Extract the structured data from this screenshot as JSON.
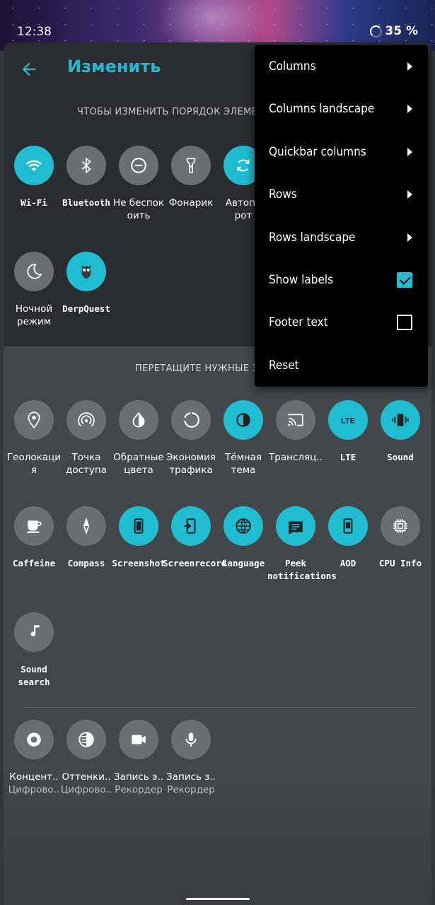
{
  "status_bar": {
    "time": "12:38",
    "battery": "35 %"
  },
  "header": {
    "title": "Изменить"
  },
  "hints": {
    "reorder": "ЧТОБЫ ИЗМЕНИТЬ ПОРЯДОК ЭЛЕМЕН",
    "drag": "ПЕРЕТАЩИТЕ НУЖНЫЕ ЭЛ"
  },
  "active_tiles": [
    {
      "label": "Wi-Fi",
      "icon": "wifi-icon",
      "on": true
    },
    {
      "label": "Bluetooth",
      "icon": "bluetooth-icon",
      "on": false
    },
    {
      "label": "Не беспок\nоить",
      "icon": "do-not-disturb-icon",
      "on": false
    },
    {
      "label": "Фонарик",
      "icon": "flashlight-icon",
      "on": false
    },
    {
      "label": "Автопо\nрот",
      "icon": "auto-rotate-icon",
      "on": true
    },
    {
      "label": "Ночной\nрежим",
      "icon": "night-mode-icon",
      "on": false
    },
    {
      "label": "DerpQuest",
      "icon": "owl-icon",
      "on": true
    }
  ],
  "available_tiles": [
    {
      "label": "Геолокаци\nя",
      "icon": "location-icon",
      "on": false
    },
    {
      "label": "Точка\nдоступа",
      "icon": "hotspot-icon",
      "on": false
    },
    {
      "label": "Обратные\nцвета",
      "icon": "invert-colors-icon",
      "on": false
    },
    {
      "label": "Экономия\nтрафика",
      "icon": "data-saver-icon",
      "on": false
    },
    {
      "label": "Тёмная\nтема",
      "icon": "dark-theme-icon",
      "on": true
    },
    {
      "label": "Трансляц..",
      "icon": "cast-icon",
      "on": false
    },
    {
      "label": "LTE",
      "icon": "lte-icon",
      "on": true
    },
    {
      "label": "Sound",
      "icon": "vibrate-icon",
      "on": true
    },
    {
      "label": "Caffeine",
      "icon": "coffee-icon",
      "on": false
    },
    {
      "label": "Compass",
      "icon": "compass-icon",
      "on": false
    },
    {
      "label": "Screenshot",
      "icon": "screenshot-icon",
      "on": true
    },
    {
      "label": "Screenrecord",
      "icon": "screenrecord-icon",
      "on": true
    },
    {
      "label": "Language",
      "icon": "globe-icon",
      "on": true
    },
    {
      "label": "Peek\nnotifications",
      "icon": "peek-icon",
      "on": true
    },
    {
      "label": "AOD",
      "icon": "aod-icon",
      "on": true
    },
    {
      "label": "CPU Info",
      "icon": "cpu-icon",
      "on": false
    },
    {
      "label": "Sound search",
      "icon": "music-note-icon",
      "on": false
    }
  ],
  "third_party_tiles": [
    {
      "label": "Концент..",
      "sub": "Цифрово..",
      "icon": "focus-icon"
    },
    {
      "label": "Оттенки..",
      "sub": "Цифрово..",
      "icon": "grayscale-icon"
    },
    {
      "label": "Запись э..",
      "sub": "Рекордер",
      "icon": "video-camera-icon"
    },
    {
      "label": "Запись з..",
      "sub": "Рекордер",
      "icon": "microphone-icon"
    }
  ],
  "menu": {
    "items": [
      {
        "label": "Columns",
        "type": "submenu"
      },
      {
        "label": "Columns landscape",
        "type": "submenu"
      },
      {
        "label": "Quickbar columns",
        "type": "submenu"
      },
      {
        "label": "Rows",
        "type": "submenu"
      },
      {
        "label": "Rows landscape",
        "type": "submenu"
      },
      {
        "label": "Show labels",
        "type": "checkbox",
        "checked": true
      },
      {
        "label": "Footer text",
        "type": "checkbox",
        "checked": false
      },
      {
        "label": "Reset",
        "type": "action"
      }
    ]
  },
  "colors": {
    "accent": "#1fbcd2",
    "title": "#25b8cf",
    "tile_off": "#6c6f72"
  }
}
